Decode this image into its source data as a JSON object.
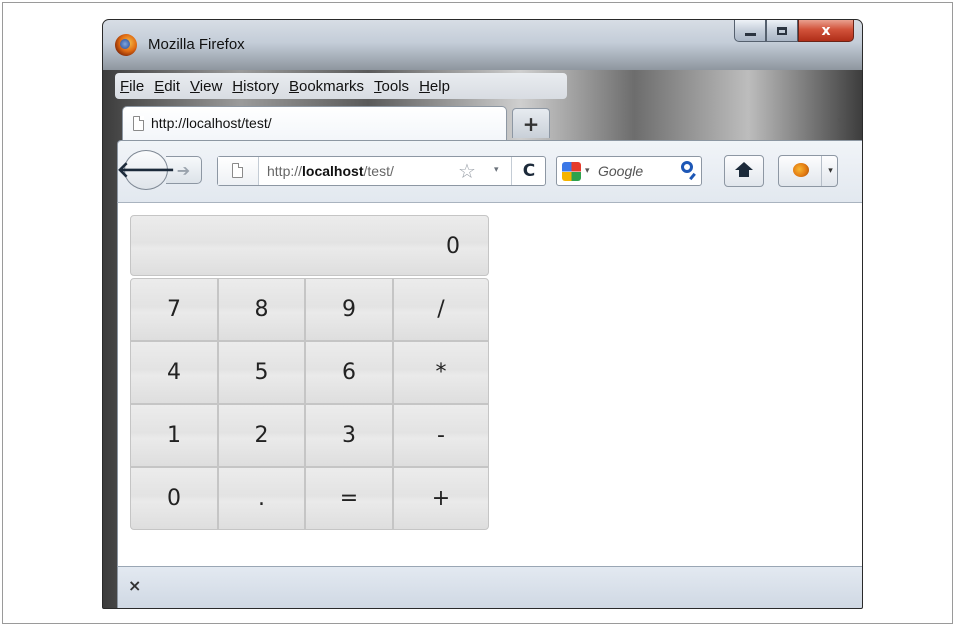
{
  "window": {
    "title": "Mozilla Firefox",
    "controls": {
      "minimize": "",
      "maximize": "",
      "close": "x"
    }
  },
  "menu": {
    "items": [
      "File",
      "Edit",
      "View",
      "History",
      "Bookmarks",
      "Tools",
      "Help"
    ]
  },
  "tabs": {
    "active_label": "http://localhost/test/",
    "new_tab_label": "+",
    "list_arrow": "▾"
  },
  "navigation": {
    "back_label": "🡐",
    "forward_label": "➔",
    "url_prefix": "http://",
    "url_host": "localhost",
    "url_path": "/test/",
    "bookmark_star": "☆",
    "url_dropdown": "▾",
    "reload_label": "C",
    "search_engine_dropdown": "▾",
    "search_placeholder": "Google",
    "addon_dropdown": "▾"
  },
  "calculator": {
    "display": "0",
    "keys": [
      [
        "7",
        "8",
        "9",
        "/"
      ],
      [
        "4",
        "5",
        "6",
        "*"
      ],
      [
        "1",
        "2",
        "3",
        "-"
      ],
      [
        "0",
        ".",
        "=",
        "+"
      ]
    ]
  },
  "statusbar": {
    "close_label": "×"
  },
  "colors": {
    "accent_close": "#c8432c",
    "chrome_bg": "#e2e8ef",
    "key_bg": "#e6e6e6"
  }
}
